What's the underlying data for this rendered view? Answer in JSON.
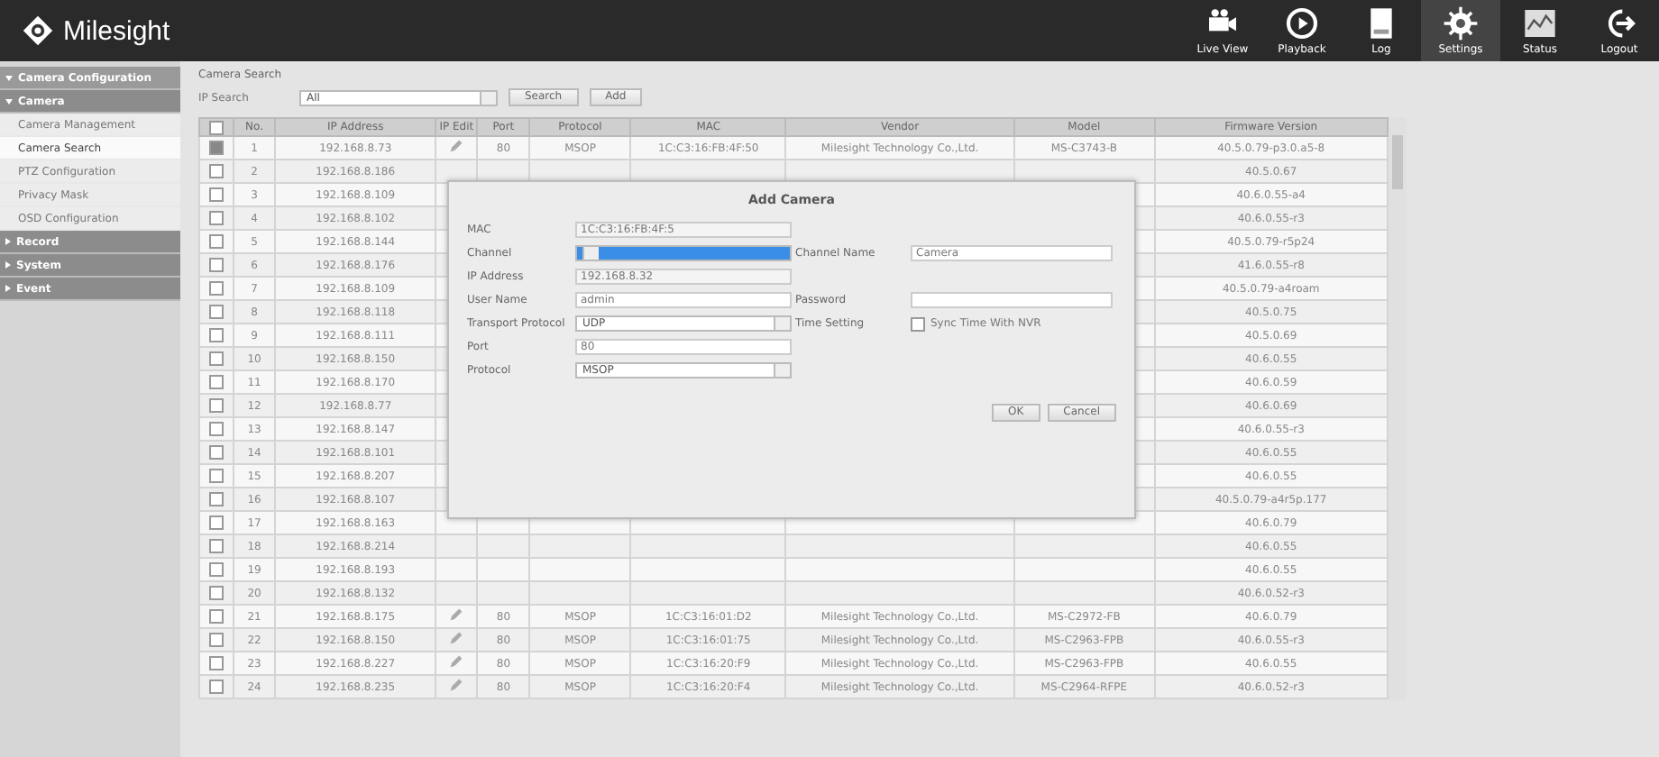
{
  "header": {
    "logo": "Milesight",
    "nav": [
      {
        "label": "Live View",
        "selected": false
      },
      {
        "label": "Playback",
        "selected": false
      },
      {
        "label": "Log",
        "selected": false
      },
      {
        "label": "Settings",
        "selected": true
      },
      {
        "label": "Status",
        "selected": false
      },
      {
        "label": "Logout",
        "selected": false
      }
    ]
  },
  "sidebar": {
    "items": [
      {
        "label": "Camera Configuration",
        "kind": "section",
        "expanded": true
      },
      {
        "label": "Camera",
        "kind": "group",
        "expanded": true,
        "children": [
          {
            "label": "Camera Management",
            "selected": false
          },
          {
            "label": "Camera Search",
            "selected": true
          },
          {
            "label": "PTZ Configuration",
            "selected": false
          },
          {
            "label": "Privacy Mask",
            "selected": false
          },
          {
            "label": "OSD Configuration",
            "selected": false
          }
        ]
      },
      {
        "label": "Record",
        "kind": "group",
        "expanded": false
      },
      {
        "label": "System",
        "kind": "group",
        "expanded": false
      },
      {
        "label": "Event",
        "kind": "group",
        "expanded": false
      }
    ]
  },
  "search": {
    "title": "Camera Search",
    "filter_label": "IP Search",
    "filter_value": "All",
    "buttons": [
      "Search",
      "Add"
    ]
  },
  "table": {
    "all_checked": false,
    "columns": [
      "No.",
      "IP Address",
      "IP Edit",
      "Port",
      "Protocol",
      "MAC",
      "Vendor",
      "Model",
      "Firmware Version"
    ],
    "rows": [
      {
        "checked": true,
        "no": "1",
        "ip": "192.168.8.73",
        "port": "80",
        "protocol": "MSOP",
        "mac": "1C:C3:16:FB:4F:50",
        "vendor": "Milesight Technology Co.,Ltd.",
        "model": "MS-C3743-B",
        "firmware": "40.5.0.79-p3.0.a5-8"
      },
      {
        "checked": false,
        "no": "2",
        "ip": "192.168.8.186",
        "firmware": "40.5.0.67"
      },
      {
        "checked": false,
        "no": "3",
        "ip": "192.168.8.109",
        "firmware": "40.6.0.55-a4"
      },
      {
        "checked": false,
        "no": "4",
        "ip": "192.168.8.102",
        "firmware": "40.6.0.55-r3"
      },
      {
        "checked": false,
        "no": "5",
        "ip": "192.168.8.144",
        "firmware": "40.5.0.79-r5p24"
      },
      {
        "checked": false,
        "no": "6",
        "ip": "192.168.8.176",
        "firmware": "41.6.0.55-r8"
      },
      {
        "checked": false,
        "no": "7",
        "ip": "192.168.8.109",
        "firmware": "40.5.0.79-a4roam"
      },
      {
        "checked": false,
        "no": "8",
        "ip": "192.168.8.118",
        "firmware": "40.5.0.75"
      },
      {
        "checked": false,
        "no": "9",
        "ip": "192.168.8.111",
        "firmware": "40.5.0.69"
      },
      {
        "checked": false,
        "no": "10",
        "ip": "192.168.8.150",
        "firmware": "40.6.0.55"
      },
      {
        "checked": false,
        "no": "11",
        "ip": "192.168.8.170",
        "firmware": "40.6.0.59"
      },
      {
        "checked": false,
        "no": "12",
        "ip": "192.168.8.77",
        "firmware": "40.6.0.69"
      },
      {
        "checked": false,
        "no": "13",
        "ip": "192.168.8.147",
        "firmware": "40.6.0.55-r3"
      },
      {
        "checked": false,
        "no": "14",
        "ip": "192.168.8.101",
        "firmware": "40.6.0.55"
      },
      {
        "checked": false,
        "no": "15",
        "ip": "192.168.8.207",
        "firmware": "40.6.0.55"
      },
      {
        "checked": false,
        "no": "16",
        "ip": "192.168.8.107",
        "firmware": "40.5.0.79-a4r5p.177"
      },
      {
        "checked": false,
        "no": "17",
        "ip": "192.168.8.163",
        "firmware": "40.6.0.79"
      },
      {
        "checked": false,
        "no": "18",
        "ip": "192.168.8.214",
        "firmware": "40.6.0.55"
      },
      {
        "checked": false,
        "no": "19",
        "ip": "192.168.8.193",
        "firmware": "40.6.0.55"
      },
      {
        "checked": false,
        "no": "20",
        "ip": "192.168.8.132",
        "firmware": "40.6.0.52-r3"
      },
      {
        "checked": false,
        "no": "21",
        "ip": "192.168.8.175",
        "port": "80",
        "protocol": "MSOP",
        "mac": "1C:C3:16:01:D2",
        "vendor": "Milesight Technology Co.,Ltd.",
        "model": "MS-C2972-FB",
        "firmware": "40.6.0.79"
      },
      {
        "checked": false,
        "no": "22",
        "ip": "192.168.8.150",
        "port": "80",
        "protocol": "MSOP",
        "mac": "1C:C3:16:01:75",
        "vendor": "Milesight Technology Co.,Ltd.",
        "model": "MS-C2963-FPB",
        "firmware": "40.6.0.55-r3"
      },
      {
        "checked": false,
        "no": "23",
        "ip": "192.168.8.227",
        "port": "80",
        "protocol": "MSOP",
        "mac": "1C:C3:16:20:F9",
        "vendor": "Milesight Technology Co.,Ltd.",
        "model": "MS-C2963-FPB",
        "firmware": "40.6.0.55"
      },
      {
        "checked": false,
        "no": "24",
        "ip": "192.168.8.235",
        "port": "80",
        "protocol": "MSOP",
        "mac": "1C:C3:16:20:F4",
        "vendor": "Milesight Technology Co.,Ltd.",
        "model": "MS-C2964-RFPE",
        "firmware": "40.6.0.52-r3"
      }
    ]
  },
  "dialog": {
    "title": "Add Camera",
    "rows": [
      {
        "left": {
          "label": "MAC",
          "kind": "readonly",
          "value": "1C:C3:16:FB:4F:5"
        }
      },
      {
        "left": {
          "label": "Channel",
          "kind": "select",
          "highlighted": true
        },
        "right": {
          "label": "Channel Name",
          "kind": "text",
          "value": "Camera"
        }
      },
      {
        "left": {
          "label": "IP Address",
          "kind": "readonly",
          "value": "192.168.8.32"
        }
      },
      {
        "left": {
          "label": "User Name",
          "kind": "text",
          "value": "admin"
        },
        "right": {
          "label": "Password",
          "kind": "password"
        }
      },
      {
        "left": {
          "label": "Transport Protocol",
          "kind": "select",
          "value": "UDP",
          "highlighted": false
        },
        "right": {
          "label": "Time Setting",
          "kind": "checkbox",
          "text": "Sync Time With NVR",
          "checked": false
        }
      },
      {
        "left": {
          "label": "Port",
          "kind": "text",
          "value": "80"
        }
      },
      {
        "left": {
          "label": "Protocol",
          "kind": "select",
          "value": "MSOP",
          "highlighted": false
        }
      }
    ],
    "buttons": [
      "OK",
      "Cancel"
    ]
  }
}
